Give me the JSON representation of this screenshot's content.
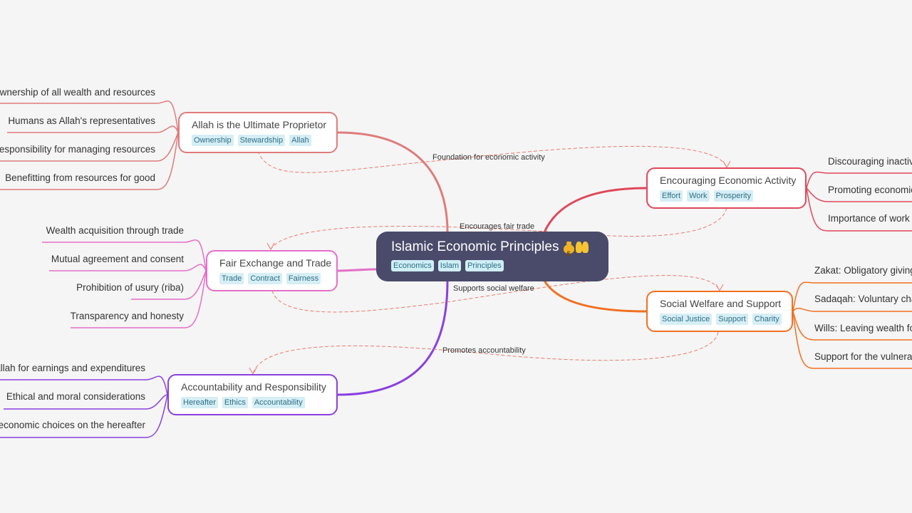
{
  "root": {
    "title": "Islamic Economic Principles",
    "emojis": [
      "money-bag-icon",
      "palms-up-icon"
    ],
    "tags": [
      "Economics",
      "Islam",
      "Principles"
    ],
    "color": "#4a4b6a"
  },
  "branches": [
    {
      "id": "proprietor",
      "title": "Allah is the Ultimate Proprietor",
      "tags": [
        "Ownership",
        "Stewardship",
        "Allah"
      ],
      "color": "#e07b7b",
      "side": "left",
      "leaves": [
        "Ownership of all wealth and resources",
        "Humans as Allah's representatives",
        "Responsibility for managing resources",
        "Benefitting from resources for good"
      ]
    },
    {
      "id": "fair-exchange",
      "title": "Fair Exchange and Trade",
      "tags": [
        "Trade",
        "Contract",
        "Fairness"
      ],
      "color": "#e46fc9",
      "side": "left",
      "leaves": [
        "Wealth acquisition through trade",
        "Mutual agreement and consent",
        "Prohibition of usury (riba)",
        "Transparency and honesty"
      ]
    },
    {
      "id": "accountability",
      "title": "Accountability and Responsibility",
      "tags": [
        "Hereafter",
        "Ethics",
        "Accountability"
      ],
      "color": "#8a3fe0",
      "side": "left",
      "leaves": [
        "Accountability to Allah for earnings and expenditures",
        "Ethical and moral considerations",
        "Impact of economic choices on the hereafter"
      ]
    },
    {
      "id": "economic-activity",
      "title": "Encouraging Economic Activity",
      "tags": [
        "Effort",
        "Work",
        "Prosperity"
      ],
      "color": "#e0475a",
      "side": "right",
      "leaves": [
        "Discouraging inactivity",
        "Promoting economic growth",
        "Importance of work"
      ]
    },
    {
      "id": "social-welfare",
      "title": "Social Welfare and Support",
      "tags": [
        "Social Justice",
        "Support",
        "Charity"
      ],
      "color": "#f07020",
      "side": "right",
      "leaves": [
        "Zakat: Obligatory giving",
        "Sadaqah: Voluntary charity",
        "Wills: Leaving wealth for others",
        "Support for the vulnerable"
      ]
    }
  ],
  "relationships": [
    {
      "from": "proprietor",
      "to": "economic-activity",
      "label": "Foundation for economic activity"
    },
    {
      "from": "economic-activity",
      "to": "fair-exchange",
      "label": "Encourages fair trade"
    },
    {
      "from": "fair-exchange",
      "to": "social-welfare",
      "label": "Supports social welfare"
    },
    {
      "from": "social-welfare",
      "to": "accountability",
      "label": "Promotes accountability"
    }
  ]
}
